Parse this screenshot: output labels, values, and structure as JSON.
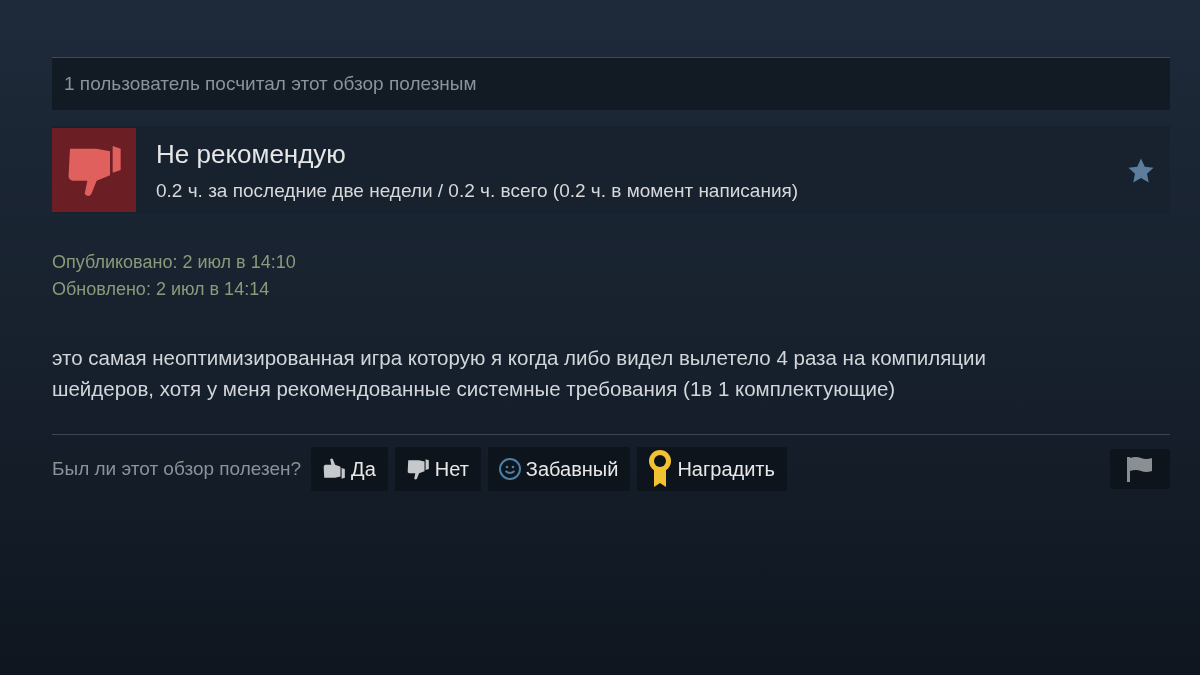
{
  "helpful_summary": "1 пользователь посчитал этот обзор полезным",
  "review": {
    "recommended": false,
    "verdict": "Не рекомендую",
    "hours": "0.2 ч. за последние две недели / 0.2 ч. всего (0.2 ч. в момент написания)"
  },
  "dates": [
    "Опубликовано: 2 июл в 14:10",
    "Обновлено: 2 июл в 14:14"
  ],
  "body": "это самая неоптимизированная игра которую я когда либо видел вылетело 4 раза на компиляции шейдеров, хотя у меня рекомендованные системные требования (1в 1 комплектующие)",
  "vote": {
    "prompt": "Был ли этот обзор полезен?",
    "buttons": [
      {
        "kind": "yes",
        "label": "Да"
      },
      {
        "kind": "no",
        "label": "Нет"
      },
      {
        "kind": "funny",
        "label": "Забавный"
      },
      {
        "kind": "award",
        "label": "Наградить"
      }
    ]
  }
}
